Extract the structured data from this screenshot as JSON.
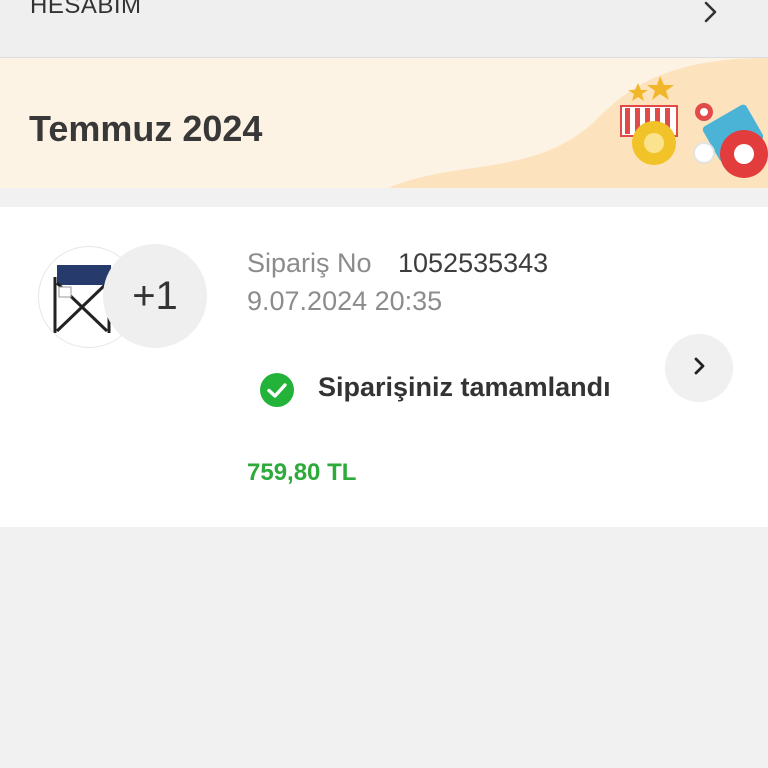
{
  "header": {
    "account_label": "HESABIM"
  },
  "month_banner": {
    "title": "Temmuz 2024"
  },
  "order": {
    "extra_items": "+1",
    "order_no_label": "Sipariş No",
    "order_no_value": "1052535343",
    "date": "9.07.2024 20:35",
    "status_text": "Siparişiniz tamamlandı",
    "price": "759,80 TL"
  },
  "colors": {
    "status_green": "#23b33a",
    "price_green": "#2eaa3a",
    "banner_bg": "#fdf3e4"
  },
  "icons": {
    "header_chevron": "chevron-right-icon",
    "status": "check-circle-icon",
    "detail": "chevron-right-icon"
  }
}
